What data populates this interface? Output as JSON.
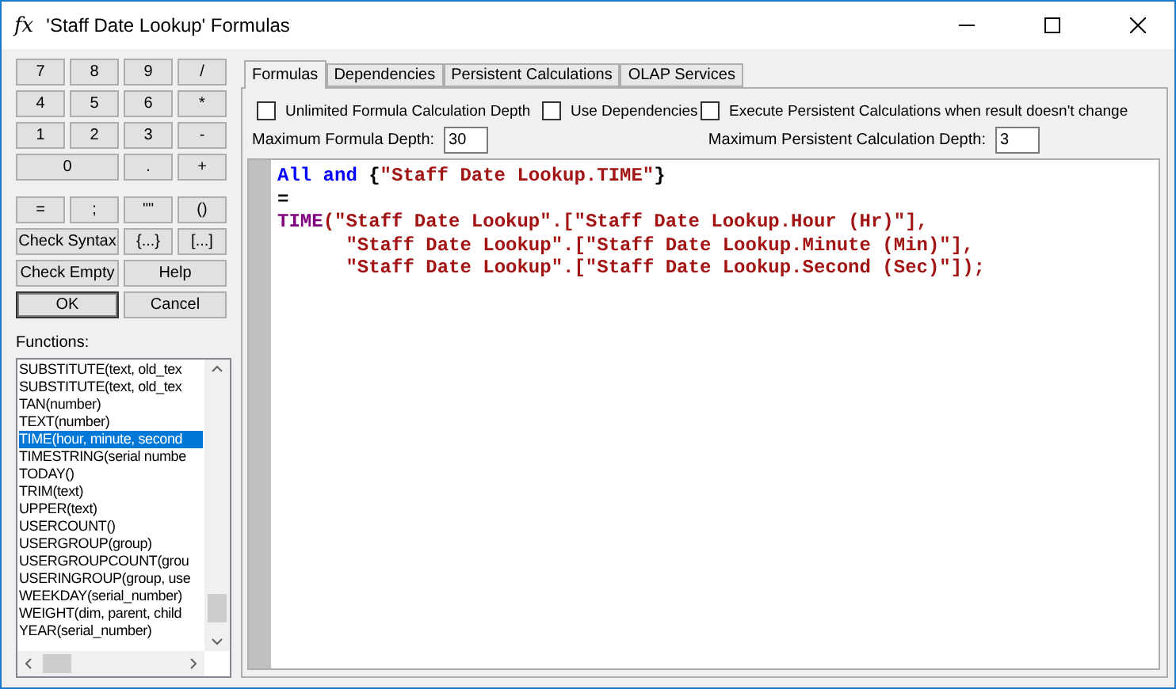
{
  "window": {
    "title": "'Staff Date Lookup' Formulas",
    "icon": "fx"
  },
  "keypad": [
    [
      {
        "label": "7"
      },
      {
        "label": "8"
      },
      {
        "label": "9"
      },
      {
        "label": "/"
      }
    ],
    [
      {
        "label": "4"
      },
      {
        "label": "5"
      },
      {
        "label": "6"
      },
      {
        "label": "*"
      }
    ],
    [
      {
        "label": "1"
      },
      {
        "label": "2"
      },
      {
        "label": "3"
      },
      {
        "label": "-"
      }
    ],
    [
      {
        "label": "0"
      },
      {
        "label": "."
      },
      {
        "label": "+"
      }
    ]
  ],
  "operators": [
    [
      {
        "label": "="
      },
      {
        "label": ";"
      },
      {
        "label": "\"\""
      },
      {
        "label": "()"
      }
    ],
    [
      {
        "label": "Check Syntax"
      },
      {
        "label": "{...}"
      },
      {
        "label": "[...]"
      }
    ],
    [
      {
        "label": "Check Empty"
      },
      {
        "label": "Help"
      }
    ],
    [
      {
        "label": "OK",
        "default": true
      },
      {
        "label": "Cancel",
        "default": false
      }
    ]
  ],
  "functions": {
    "label": "Functions:",
    "items": [
      {
        "text": "SUBSTITUTE(text, old_tex",
        "selected": false
      },
      {
        "text": "SUBSTITUTE(text, old_tex",
        "selected": false
      },
      {
        "text": "TAN(number)",
        "selected": false
      },
      {
        "text": "TEXT(number)",
        "selected": false
      },
      {
        "text": "TIME(hour, minute, second",
        "selected": true
      },
      {
        "text": "TIMESTRING(serial numbe",
        "selected": false
      },
      {
        "text": "TODAY()",
        "selected": false
      },
      {
        "text": "TRIM(text)",
        "selected": false
      },
      {
        "text": "UPPER(text)",
        "selected": false
      },
      {
        "text": "USERCOUNT()",
        "selected": false
      },
      {
        "text": "USERGROUP(group)",
        "selected": false
      },
      {
        "text": "USERGROUPCOUNT(grou",
        "selected": false
      },
      {
        "text": "USERINGROUP(group, use",
        "selected": false
      },
      {
        "text": "WEEKDAY(serial_number)",
        "selected": false
      },
      {
        "text": "WEIGHT(dim, parent, child",
        "selected": false
      },
      {
        "text": "YEAR(serial_number)",
        "selected": false
      }
    ]
  },
  "tabs": [
    {
      "label": "Formulas",
      "selected": true
    },
    {
      "label": "Dependencies",
      "selected": false
    },
    {
      "label": "Persistent Calculations",
      "selected": false
    },
    {
      "label": "OLAP Services",
      "selected": false
    }
  ],
  "options": [
    {
      "label": "Unlimited Formula Calculation Depth",
      "checked": false
    },
    {
      "label": "Use Dependencies",
      "checked": false
    },
    {
      "label": "Execute Persistent Calculations when result doesn't change",
      "checked": false
    }
  ],
  "depth_fields": [
    {
      "label": "Maximum Formula Depth:",
      "value": "30"
    },
    {
      "label": "Maximum Persistent Calculation Depth:",
      "value": "3"
    }
  ],
  "code_lines": [
    [
      {
        "kind": "keyword",
        "text": "All"
      },
      {
        "kind": "keyword",
        "text": "and"
      },
      {
        "kind": "plain",
        "text": "{"
      },
      {
        "kind": "string",
        "text": "\"Staff Date Lookup.TIME\""
      },
      {
        "kind": "plain",
        "text": "}"
      }
    ],
    [
      {
        "kind": "plain",
        "text": "="
      }
    ],
    [
      {
        "kind": "function",
        "text": "TIME"
      },
      {
        "kind": "string",
        "text": "(\"Staff Date Lookup\".[\"Staff Date Lookup.Hour (Hr)\"],"
      }
    ],
    [
      {
        "kind": "string",
        "text": "      \"Staff Date Lookup\".[\"Staff Date Lookup.Minute (Min)\"],"
      }
    ],
    [
      {
        "kind": "string",
        "text": "      \"Staff Date Lookup\".[\"Staff Date Lookup.Second (Sec)\"]);"
      }
    ]
  ]
}
